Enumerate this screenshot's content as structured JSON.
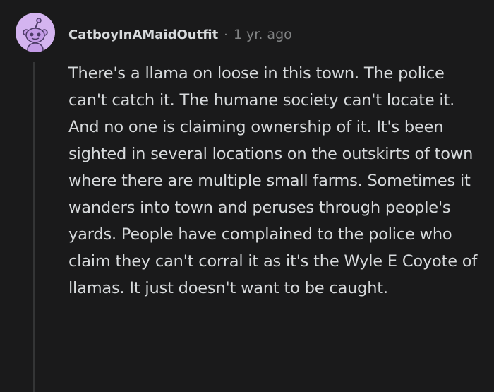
{
  "comment": {
    "avatar_icon": "reddit-snoo-avatar-icon",
    "avatar_color": "#d4b4f0",
    "username": "CatboyInAMaidOutfit",
    "separator": "·",
    "timestamp": "1 yr. ago",
    "body": "There's a llama on loose in this town. The police can't catch it. The humane society can't locate it. And no one is claiming ownership of it. It's been sighted in several locations on the outskirts of town where there are multiple small farms. Sometimes it wanders into town and peruses through people's yards. People have complained to the police who claim they can't corral it as it's the Wyle E Coyote of llamas. It just doesn't want to be caught."
  },
  "colors": {
    "background": "#1a1a1b",
    "text": "#d7dadc",
    "meta": "#818384",
    "thread_line": "#343536"
  }
}
